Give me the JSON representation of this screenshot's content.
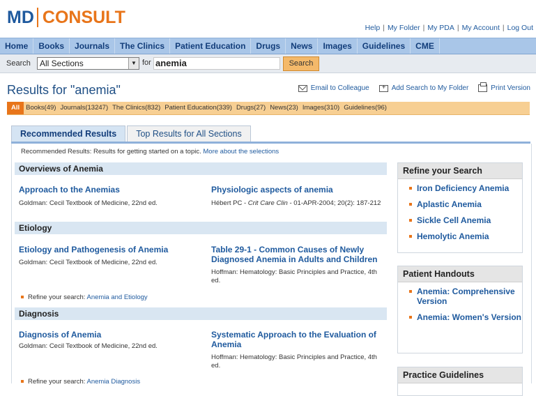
{
  "logo": {
    "left": "MD",
    "right": "CONSULT"
  },
  "toplinks": [
    "Help",
    "My Folder",
    "My PDA",
    "My Account",
    "Log Out"
  ],
  "toplinks_sep": "|",
  "nav": [
    "Home",
    "Books",
    "Journals",
    "The Clinics",
    "Patient Education",
    "Drugs",
    "News",
    "Images",
    "Guidelines",
    "CME"
  ],
  "search": {
    "label": "Search",
    "section": "All Sections",
    "for_label": "for",
    "query": "anemia",
    "button": "Search"
  },
  "results": {
    "title": "Results for \"anemia\""
  },
  "actions": {
    "email": "Email to Colleague",
    "add": "Add Search to My Folder",
    "print": "Print Version"
  },
  "categories": {
    "all": "All",
    "items": [
      "Books(49)",
      "Journals(13247)",
      "The Clinics(832)",
      "Patient Education(339)",
      "Drugs(27)",
      "News(23)",
      "Images(310)",
      "Guidelines(96)"
    ]
  },
  "tabs": {
    "active": "Recommended Results",
    "inactive": "Top Results for All Sections"
  },
  "intro": {
    "text": "Recommended Results: Results for getting started on a topic. ",
    "link": "More about the selections"
  },
  "sections": [
    {
      "head": "Overviews of Anemia",
      "left": {
        "title": "Approach to the Anemias",
        "src": "Goldman: Cecil Textbook of Medicine, 22nd ed."
      },
      "right": {
        "title": "Physiologic aspects of anemia",
        "src_author": "Hébert PC - ",
        "src_journal": "Crit Care Clin",
        "src_rest": " - 01-APR-2004; 20(2): 187-212"
      }
    },
    {
      "head": "Etiology",
      "left": {
        "title": "Etiology and Pathogenesis of Anemia",
        "src": "Goldman: Cecil Textbook of Medicine, 22nd ed."
      },
      "right": {
        "title": "Table 29-1 - Common Causes of Newly Diagnosed Anemia in Adults and Children",
        "src": "Hoffman: Hematology: Basic Principles and Practice, 4th ed."
      },
      "refine": {
        "label": "Refine your search: ",
        "link": "Anemia and Etiology"
      }
    },
    {
      "head": "Diagnosis",
      "left": {
        "title": "Diagnosis of Anemia",
        "src": "Goldman: Cecil Textbook of Medicine, 22nd ed."
      },
      "right": {
        "title": "Systematic Approach to the Evaluation of Anemia",
        "src": "Hoffman: Hematology: Basic Principles and Practice, 4th ed."
      },
      "refine": {
        "label": "Refine your search: ",
        "link": "Anemia Diagnosis"
      }
    }
  ],
  "sidebar": {
    "refine": {
      "head": "Refine your Search",
      "items": [
        "Iron Deficiency Anemia",
        "Aplastic Anemia",
        "Sickle Cell Anemia",
        "Hemolytic Anemia"
      ]
    },
    "handouts": {
      "head": "Patient Handouts",
      "items": [
        "Anemia: Comprehensive Version",
        "Anemia: Women's Version"
      ]
    },
    "guidelines": {
      "head": "Practice Guidelines"
    }
  },
  "colors": {
    "brand_blue": "#1f5a9e",
    "brand_orange": "#e8751a",
    "nav_blue": "#a9c6e8",
    "category_strip": "#f7cf93"
  }
}
